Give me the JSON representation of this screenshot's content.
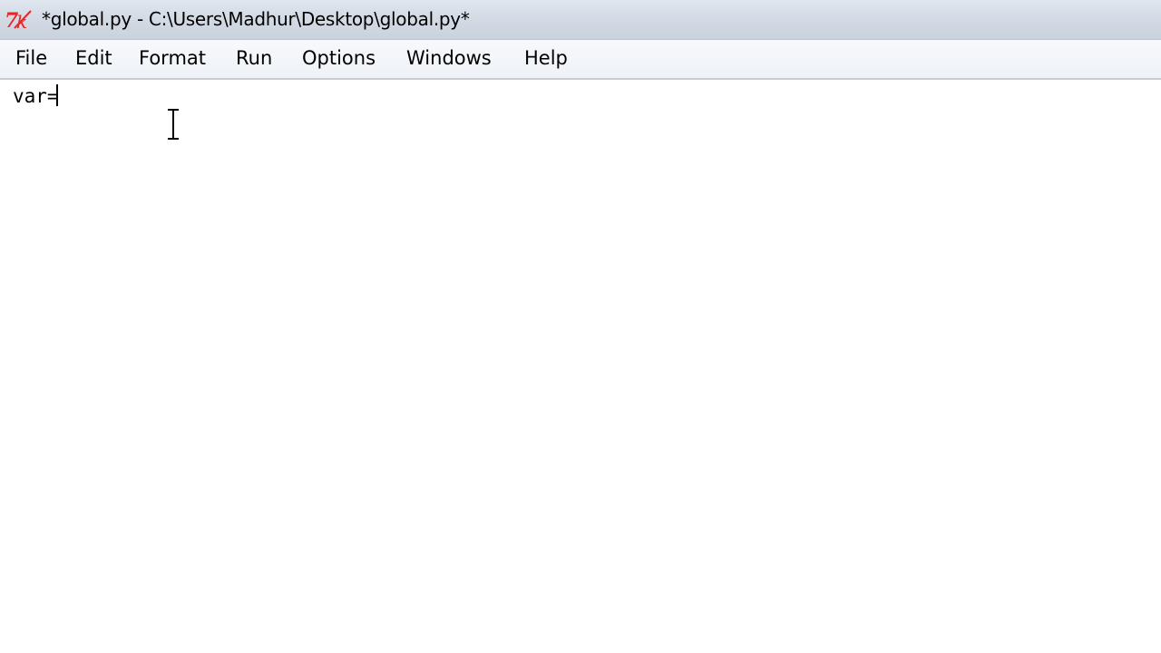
{
  "window": {
    "title": "*global.py - C:\\Users\\Madhur\\Desktop\\global.py*",
    "icon": "python-idle-icon"
  },
  "menubar": {
    "items": [
      {
        "label": "File"
      },
      {
        "label": "Edit"
      },
      {
        "label": "Format"
      },
      {
        "label": "Run"
      },
      {
        "label": "Options"
      },
      {
        "label": "Windows"
      },
      {
        "label": "Help"
      }
    ]
  },
  "editor": {
    "lines": [
      "var="
    ],
    "cursor": "i-beam-cursor-icon"
  },
  "colors": {
    "title_bar": "#d3dbe5",
    "menu_bar": "#f2f5f9",
    "editor_background": "#ffffff",
    "icon_red": "#e8262a"
  }
}
